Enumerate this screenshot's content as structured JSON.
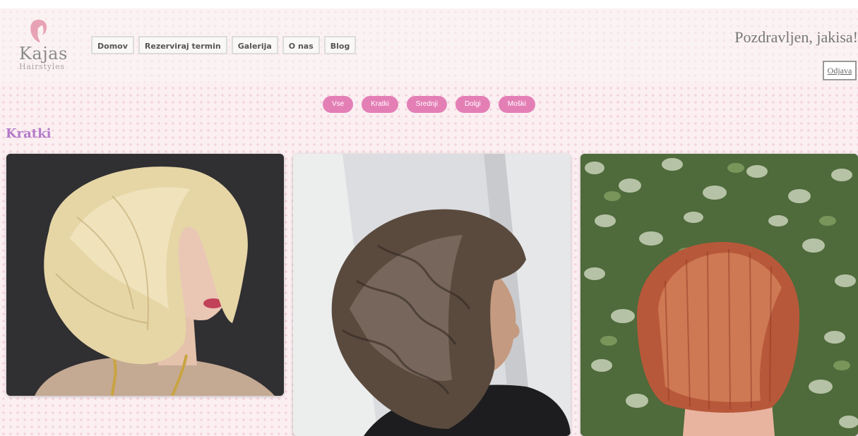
{
  "brand": {
    "name": "Kajas",
    "tagline": "Hairstyles"
  },
  "nav": {
    "items": [
      "Domov",
      "Rezerviraj termin",
      "Galerija",
      "O nas",
      "Blog"
    ]
  },
  "user": {
    "greeting": "Pozdravljen, jakisa!",
    "logout_label": "Odjava"
  },
  "filters": [
    "Vse",
    "Kratki",
    "Srednji",
    "Dolgi",
    "Moški"
  ],
  "section": {
    "title": "Kratki"
  },
  "gallery": [
    {
      "image": "short blonde layered bob, dark background"
    },
    {
      "image": "brunette wavy layered bob, light background"
    },
    {
      "image": "copper straight bob, green leafy wall background"
    }
  ],
  "colors": {
    "accent_pink": "#e47fb6",
    "title_purple": "#b37ac9",
    "background": "#fbeff2"
  }
}
